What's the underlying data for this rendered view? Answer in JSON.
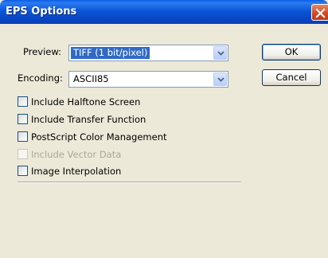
{
  "window": {
    "title": "EPS Options"
  },
  "preview": {
    "label": "Preview:",
    "value": "TIFF  (1 bit/pixel)"
  },
  "encoding": {
    "label": "Encoding:",
    "value": "ASCII85"
  },
  "buttons": {
    "ok": "OK",
    "cancel": "Cancel"
  },
  "options": [
    {
      "label": "Include Halftone Screen",
      "checked": false,
      "enabled": true
    },
    {
      "label": "Include Transfer Function",
      "checked": false,
      "enabled": true
    },
    {
      "label": "PostScript Color Management",
      "checked": false,
      "enabled": true
    },
    {
      "label": "Include Vector Data",
      "checked": false,
      "enabled": false
    },
    {
      "label": "Image Interpolation",
      "checked": false,
      "enabled": true
    }
  ],
  "icons": {
    "close": "close-icon",
    "dropdown": "chevron-down-icon"
  }
}
